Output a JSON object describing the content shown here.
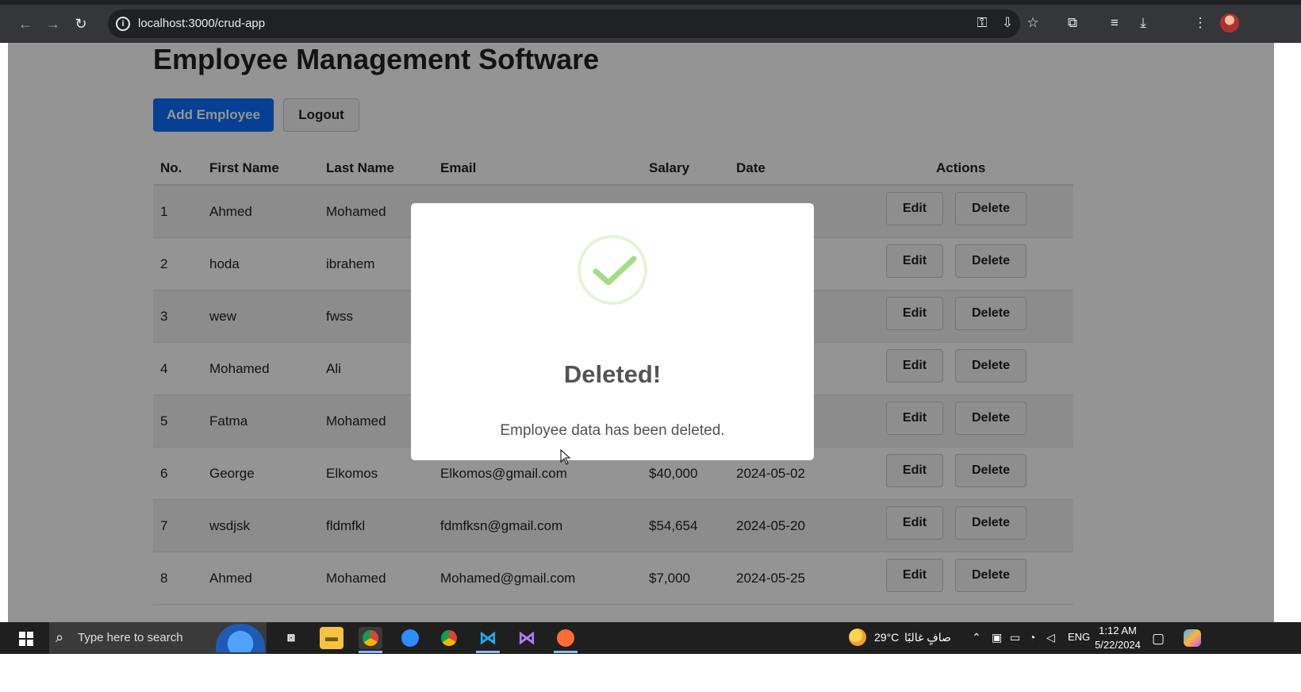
{
  "browser": {
    "url": "localhost:3000/crud-app"
  },
  "page": {
    "title": "Employee Management Software",
    "add_button": "Add Employee",
    "logout_button": "Logout"
  },
  "table": {
    "headers": [
      "No.",
      "First Name",
      "Last Name",
      "Email",
      "Salary",
      "Date",
      "Actions"
    ],
    "edit_label": "Edit",
    "delete_label": "Delete",
    "rows": [
      {
        "no": "1",
        "first": "Ahmed",
        "last": "Mohamed",
        "email": "",
        "salary": "",
        "date": ""
      },
      {
        "no": "2",
        "first": "hoda",
        "last": "ibrahem",
        "email": "",
        "salary": "",
        "date": ""
      },
      {
        "no": "3",
        "first": "wew",
        "last": "fwss",
        "email": "",
        "salary": "",
        "date": ""
      },
      {
        "no": "4",
        "first": "Mohamed",
        "last": "Ali",
        "email": "",
        "salary": "",
        "date": ""
      },
      {
        "no": "5",
        "first": "Fatma",
        "last": "Mohamed",
        "email": "",
        "salary": "",
        "date": ""
      },
      {
        "no": "6",
        "first": "George",
        "last": "Elkomos",
        "email": "Elkomos@gmail.com",
        "salary": "$40,000",
        "date": "2024-05-02"
      },
      {
        "no": "7",
        "first": "wsdjsk",
        "last": "fldmfkl",
        "email": "fdmfksn@gmail.com",
        "salary": "$54,654",
        "date": "2024-05-20"
      },
      {
        "no": "8",
        "first": "Ahmed",
        "last": "Mohamed",
        "email": "Mohamed@gmail.com",
        "salary": "$7,000",
        "date": "2024-05-25"
      }
    ]
  },
  "modal": {
    "title": "Deleted!",
    "text": "Employee data has been deleted.",
    "icon": "success-check-icon",
    "icon_color": "#a5dc86"
  },
  "taskbar": {
    "search_placeholder": "Type here to search",
    "weather": "29°C",
    "weather_desc": "صافٍ غالبًا",
    "language": "ENG",
    "time": "1:12 AM",
    "date": "5/22/2024"
  },
  "colors": {
    "primary": "#0d6efd",
    "overlay": "rgba(0,0,0,0.42)"
  }
}
